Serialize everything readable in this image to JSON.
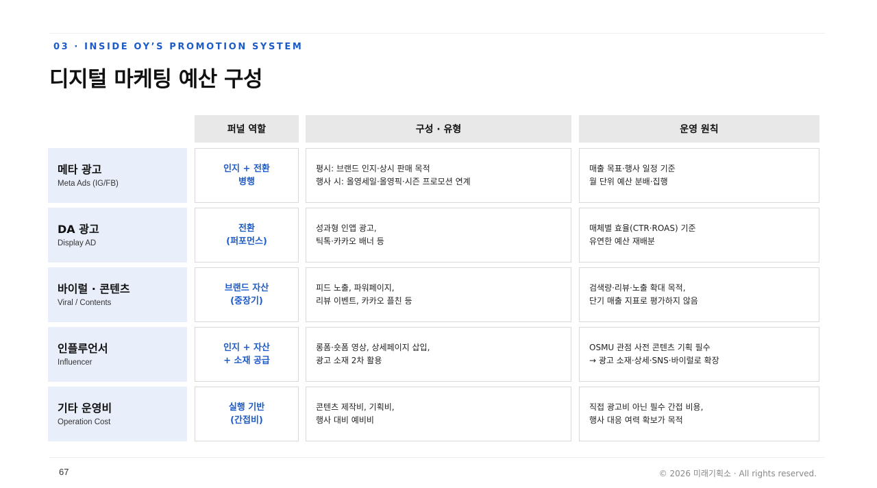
{
  "header": {
    "eyebrow": "03 · INSIDE OY’S PROMOTION SYSTEM",
    "title": "디지털 마케팅 예산 구성"
  },
  "table": {
    "columns": [
      "퍼널 역할",
      "구성 · 유형",
      "운영 원칙"
    ],
    "rows": [
      {
        "name_ko": "메타 광고",
        "name_en": "Meta Ads (IG/FB)",
        "role": [
          "인지 + 전환",
          "병행"
        ],
        "composition": [
          "평시: 브랜드 인지·상시 판매 목적",
          "행사 시: 올영세일·올영픽·시즌 프로모션 연계"
        ],
        "principle": [
          "매출 목표·행사 일정 기준",
          "월 단위 예산 분배·집행"
        ]
      },
      {
        "name_ko": "DA 광고",
        "name_en": "Display AD",
        "role": [
          "전환",
          "(퍼포먼스)"
        ],
        "composition": [
          "성과형 인앱 광고,",
          "틱톡·카카오 배너 등"
        ],
        "principle": [
          "매체별 효율(CTR·ROAS) 기준",
          "유연한 예산 재배분"
        ]
      },
      {
        "name_ko": "바이럴 · 콘텐츠",
        "name_en": "Viral / Contents",
        "role": [
          "브랜드 자산",
          "(중장기)"
        ],
        "composition": [
          "피드 노출, 파워페이지,",
          "리뷰 이벤트, 카카오 플친 등"
        ],
        "principle": [
          "검색량·리뷰·노출 확대 목적,",
          "단기 매출 지표로 평가하지 않음"
        ]
      },
      {
        "name_ko": "인플루언서",
        "name_en": "Influencer",
        "role": [
          "인지 + 자산",
          "+ 소재 공급"
        ],
        "composition": [
          "롱폼·숏폼 영상, 상세페이지 삽입,",
          "광고 소재 2차 활용"
        ],
        "principle": [
          "OSMU 관점 사전 콘텐츠 기획 필수",
          "→ 광고 소재·상세·SNS·바이럴로 확장"
        ]
      },
      {
        "name_ko": "기타 운영비",
        "name_en": "Operation Cost",
        "role": [
          "실행 기반",
          "(간접비)"
        ],
        "composition": [
          "콘텐츠 제작비, 기획비,",
          "행사 대비 예비비"
        ],
        "principle": [
          "직접 광고비 아닌 필수 간접 비용,",
          "행사 대응 여력 확보가 목적"
        ]
      }
    ]
  },
  "footer": {
    "page_number": "67",
    "copyright": "© 2026 미래기획소 · All rights reserved."
  }
}
